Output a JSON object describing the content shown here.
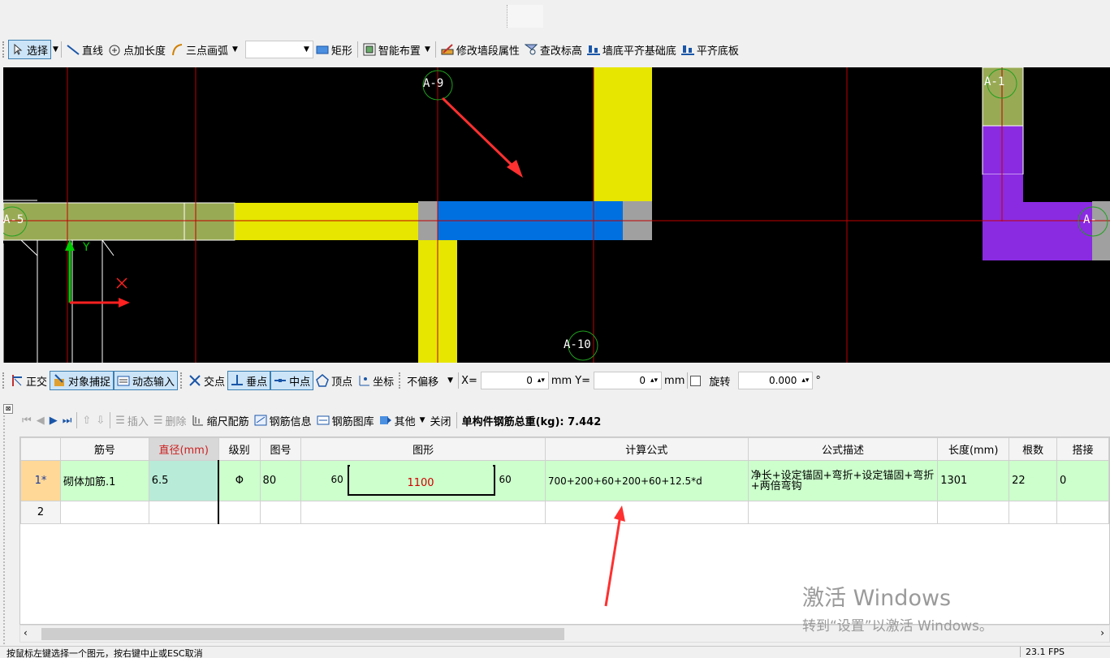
{
  "toolbar": {
    "select": "选择",
    "line": "直线",
    "point_length": "点加长度",
    "arc": "三点画弧",
    "rect": "矩形",
    "smart_layout": "智能布置",
    "edit_segment": "修改墙段属性",
    "edit_elevation": "查改标高",
    "align_bottom_base": "墙底平齐基础底",
    "align_bottom_slab": "平齐底板"
  },
  "canvas": {
    "axes": [
      "A-9",
      "A-10",
      "A-1",
      "A-5",
      "A-"
    ],
    "ucs_y": "Y",
    "ucs_x": "X"
  },
  "snapbar": {
    "ortho": "正交",
    "object_snap": "对象捕捉",
    "dynamic_input": "动态输入",
    "intersection": "交点",
    "perpendicular": "垂点",
    "midpoint": "中点",
    "vertex": "顶点",
    "coordinate": "坐标",
    "offset_mode": "不偏移",
    "x_label": "X=",
    "x_value": "0",
    "unit": "mm",
    "y_label": "Y=",
    "y_value": "0",
    "rotate_label": "旋转",
    "rotate_value": "0.000",
    "degree": "°"
  },
  "gridbar": {
    "insert": "插入",
    "delete": "删除",
    "scale_rebar": "缩尺配筋",
    "rebar_info": "钢筋信息",
    "rebar_library": "钢筋图库",
    "other": "其他",
    "close": "关闭",
    "total_weight": "单构件钢筋总重(kg): 7.442"
  },
  "table": {
    "headers": [
      "筋号",
      "直径(mm)",
      "级别",
      "图号",
      "图形",
      "计算公式",
      "公式描述",
      "长度(mm)",
      "根数",
      "搭接"
    ],
    "rows": [
      {
        "row_no": "1*",
        "name": "砌体加筋.1",
        "diameter": "6.5",
        "grade": "Φ",
        "figure_no": "80",
        "shape_left": "60",
        "shape_mid": "1100",
        "shape_right": "60",
        "formula": "700+200+60+200+60+12.5*d",
        "description": "净长+设定锚固+弯折+设定锚固+弯折+两倍弯钩",
        "length": "1301",
        "count": "22",
        "lap": "0"
      },
      {
        "row_no": "2"
      }
    ]
  },
  "watermark": {
    "line1": "激活 Windows",
    "line2": "转到“设置”以激活 Windows。"
  },
  "status": {
    "left": "按鼠标左键选择一个图元，按右键中止或ESC取消",
    "right": "23.1 FPS"
  },
  "colors": {
    "canvas_bg": "#000000",
    "wall_yellow": "#e6e600",
    "wall_olive": "#99aa55",
    "wall_blue": "#0070e0",
    "wall_purple": "#8a2be2",
    "row_green": "#ccffcc",
    "axis_red": "#c00000"
  }
}
